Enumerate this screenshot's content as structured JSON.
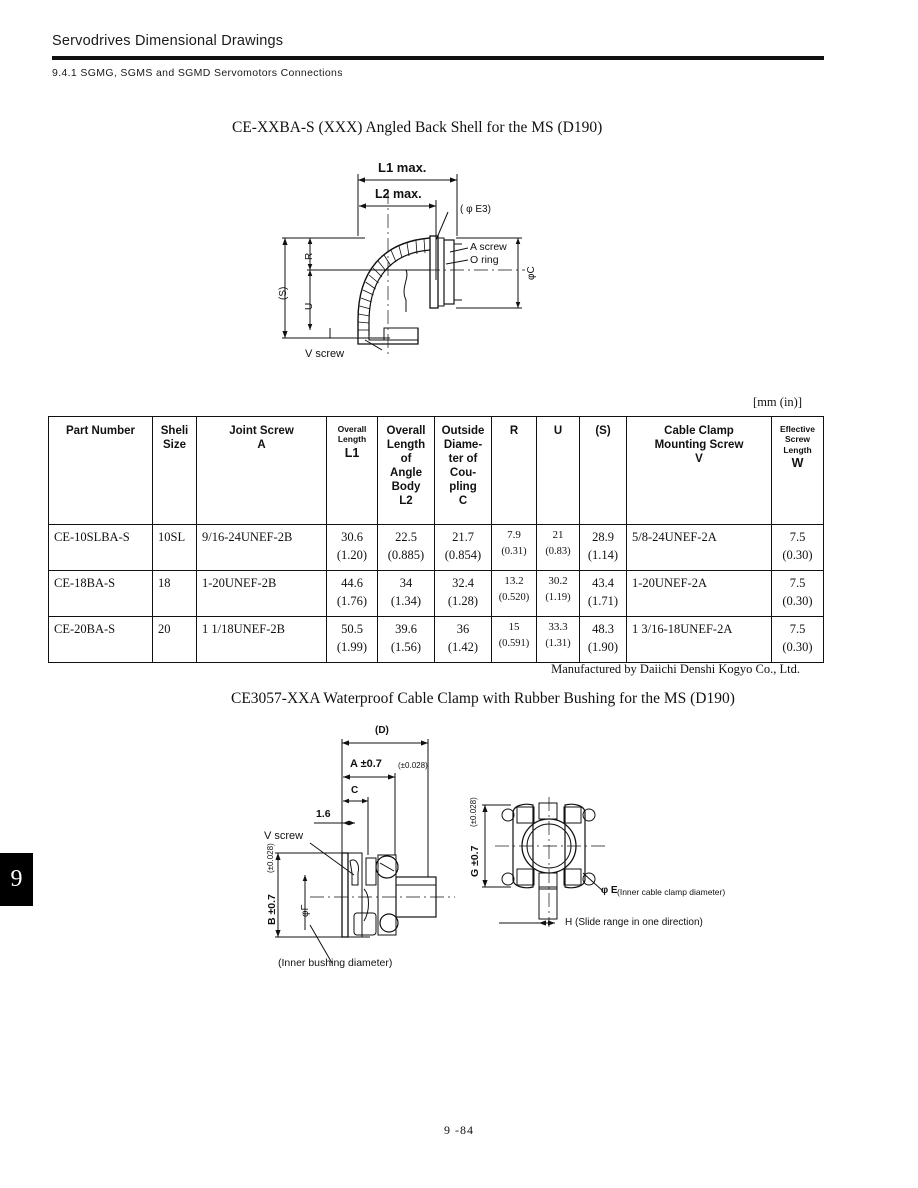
{
  "header": {
    "title": "Servodrives Dimensional Drawings",
    "section": "9.4.1  SGMG, SGMS and SGMD Servomotors Connections",
    "chapter_tab": "9"
  },
  "footer": {
    "page_number": "9 -84"
  },
  "figure1": {
    "title": "CE-XXBA-S (XXX) Angled Back Shell for the MS (D190)",
    "labels": {
      "l1": "L1 max.",
      "l2": "L2 max.",
      "e3": "( φ E3)",
      "a_screw": "A screw",
      "o_ring": "O ring",
      "phi_c": "φC",
      "s": "(S)",
      "r": "R",
      "u": "U",
      "v_screw": "V screw"
    }
  },
  "table": {
    "unit_note": "[mm (in)]",
    "manufacturer_note": "Manufactured by Daiichi Denshi Kogyo Co., Ltd.",
    "headers": [
      {
        "lines": [
          "Part Number"
        ],
        "style": "normal"
      },
      {
        "lines": [
          "Sheli",
          "Size"
        ],
        "style": "normal"
      },
      {
        "lines": [
          "Joint Screw",
          "A"
        ],
        "style": "normal"
      },
      {
        "lines": [
          "Overall",
          "Length"
        ],
        "symbol": "L1",
        "style": "small"
      },
      {
        "lines": [
          "Overall",
          "Length",
          "of",
          "Angle",
          "Body",
          "L2"
        ],
        "style": "normal"
      },
      {
        "lines": [
          "Outside",
          "Diame-",
          "ter of",
          "Cou-",
          "pling",
          "C"
        ],
        "style": "normal"
      },
      {
        "lines": [
          "R"
        ],
        "style": "normal"
      },
      {
        "lines": [
          "U"
        ],
        "style": "normal"
      },
      {
        "lines": [
          "(S)"
        ],
        "style": "normal"
      },
      {
        "lines": [
          "Cable Clamp",
          "Mounting Screw",
          "V"
        ],
        "style": "normal"
      },
      {
        "lines": [
          "Eflective",
          "Screw",
          "Length"
        ],
        "symbol": "W",
        "style": "small"
      }
    ],
    "rows": [
      {
        "part_number": "CE-10SLBA-S",
        "shell_size": "10SL",
        "joint_screw_a": "9/16-24UNEF-2B",
        "l1": {
          "mm": "30.6",
          "in": "(1.20)"
        },
        "l2": {
          "mm": "22.5",
          "in": "(0.885)"
        },
        "c": {
          "mm": "21.7",
          "in": "(0.854)"
        },
        "r": {
          "mm": "7.9",
          "in": "(0.31)"
        },
        "u": {
          "mm": "21",
          "in": "(0.83)"
        },
        "s": {
          "mm": "28.9",
          "in": "(1.14)"
        },
        "v": "5/8-24UNEF-2A",
        "w": {
          "mm": "7.5",
          "in": "(0.30)"
        }
      },
      {
        "part_number": "CE-18BA-S",
        "shell_size": "18",
        "joint_screw_a": "1-20UNEF-2B",
        "l1": {
          "mm": "44.6",
          "in": "(1.76)"
        },
        "l2": {
          "mm": "34",
          "in": "(1.34)"
        },
        "c": {
          "mm": "32.4",
          "in": "(1.28)"
        },
        "r": {
          "mm": "13.2",
          "in": "(0.520)"
        },
        "u": {
          "mm": "30.2",
          "in": "(1.19)"
        },
        "s": {
          "mm": "43.4",
          "in": "(1.71)"
        },
        "v": "1-20UNEF-2A",
        "w": {
          "mm": "7.5",
          "in": "(0.30)"
        }
      },
      {
        "part_number": "CE-20BA-S",
        "shell_size": "20",
        "joint_screw_a": "1 1/18UNEF-2B",
        "l1": {
          "mm": "50.5",
          "in": "(1.99)"
        },
        "l2": {
          "mm": "39.6",
          "in": "(1.56)"
        },
        "c": {
          "mm": "36",
          "in": "(1.42)"
        },
        "r": {
          "mm": "15",
          "in": "(0.591)"
        },
        "u": {
          "mm": "33.3",
          "in": "(1.31)"
        },
        "s": {
          "mm": "48.3",
          "in": "(1.90)"
        },
        "v": "1 3/16-18UNEF-2A",
        "w": {
          "mm": "7.5",
          "in": "(0.30)"
        }
      }
    ]
  },
  "figure2": {
    "title": "CE3057-XXA Waterproof Cable Clamp with Rubber Bushing for the MS (D190)",
    "labels_left": {
      "d": "(D)",
      "a": "A ±0.7",
      "a_tol": "(±0.028)",
      "c": "C",
      "dim_1_6": "1.6",
      "v_screw": "V screw",
      "b": "B ±0.7",
      "b_tol": "(±0.028)",
      "phi_f": "φF",
      "inner_bushing": "(Inner bushing diameter)"
    },
    "labels_right": {
      "g": "G ±0.7",
      "g_tol": "(±0.028)",
      "phi_e": "φ E",
      "inner_clamp": "(Inner cable clamp diameter)",
      "h": "H (Slide range in one direction)"
    }
  }
}
